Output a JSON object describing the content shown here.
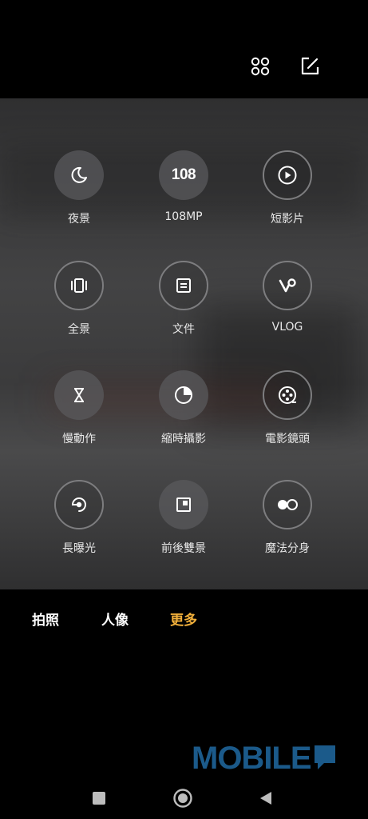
{
  "top_bar": {
    "icons": [
      "grid-icon",
      "edit-icon"
    ]
  },
  "modes": [
    {
      "label": "夜景",
      "icon": "moon-icon"
    },
    {
      "label": "108MP",
      "icon": "108-text",
      "icon_text": "108"
    },
    {
      "label": "短影片",
      "icon": "play-circle-icon"
    },
    {
      "label": "全景",
      "icon": "panorama-icon"
    },
    {
      "label": "文件",
      "icon": "document-icon"
    },
    {
      "label": "VLOG",
      "icon": "vlog-icon"
    },
    {
      "label": "慢動作",
      "icon": "hourglass-icon"
    },
    {
      "label": "縮時攝影",
      "icon": "timer-icon"
    },
    {
      "label": "電影鏡頭",
      "icon": "film-reel-icon"
    },
    {
      "label": "長曝光",
      "icon": "long-exposure-icon"
    },
    {
      "label": "前後雙景",
      "icon": "dual-view-icon"
    },
    {
      "label": "魔法分身",
      "icon": "clone-icon"
    }
  ],
  "tabs": [
    {
      "label": "拍照",
      "active": false
    },
    {
      "label": "人像",
      "active": false
    },
    {
      "label": "更多",
      "active": true
    }
  ],
  "colors": {
    "active_tab": "#f2b03b",
    "status_dot": "#22c55e",
    "watermark": "#1b5a8a"
  },
  "watermark": "MOBILE",
  "nav": [
    "recents-button",
    "home-button",
    "back-button"
  ]
}
